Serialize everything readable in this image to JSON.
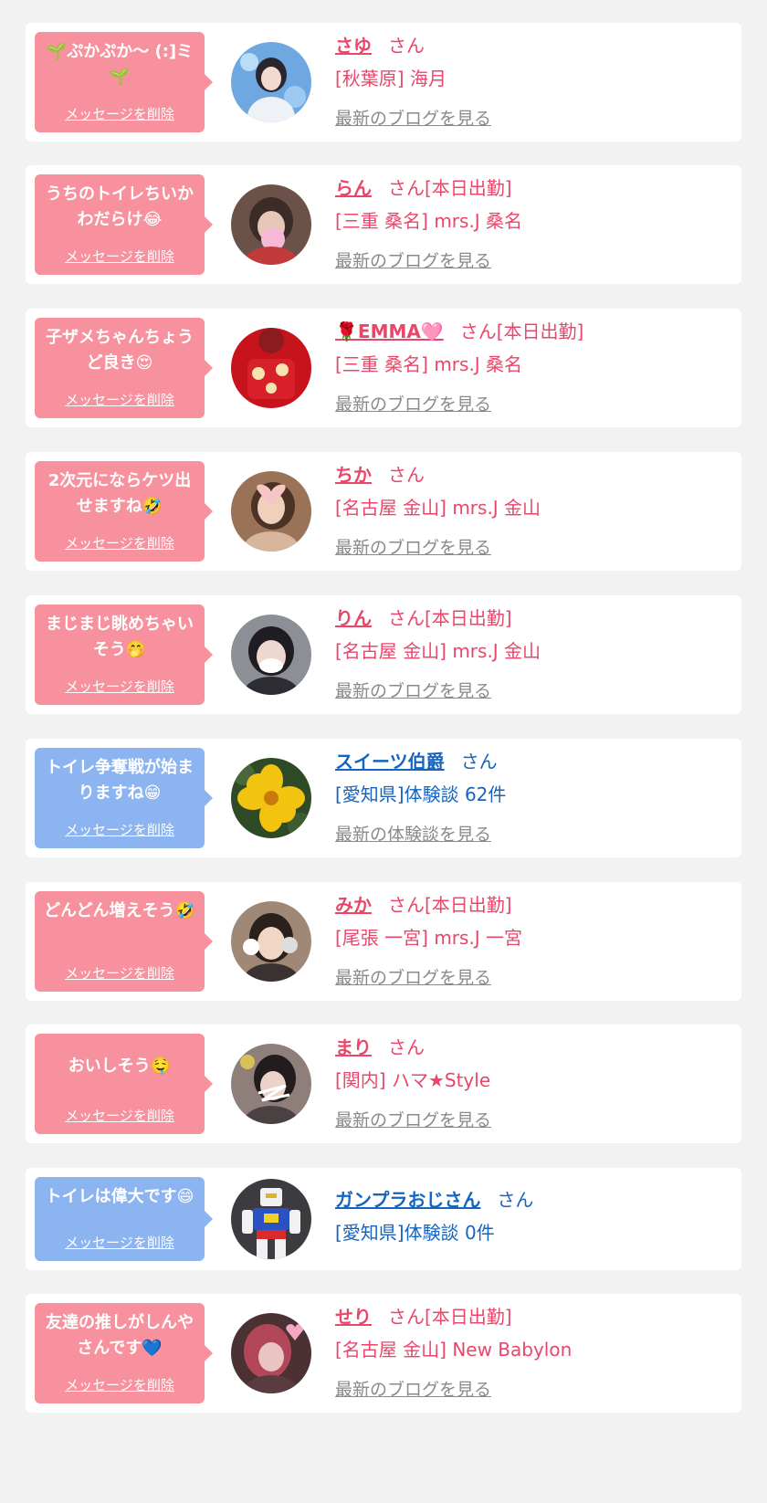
{
  "common": {
    "delete_label": "メッセージを削除",
    "san": "さん",
    "shift_badge": "[本日出勤]"
  },
  "colors": {
    "pink_text": "#e8476a",
    "blue_text": "#1565c0",
    "pink_bubble": "#f7919e",
    "blue_bubble": "#8cb4f0",
    "link_gray": "#8a8a8a"
  },
  "items": [
    {
      "message": "🌱ぷかぷか〜 (:]ミ🌱",
      "name": "さゆ",
      "badge": "",
      "subtitle": "[秋葉原] 海月",
      "link": "最新のブログを見る",
      "kind": "cast",
      "avatar_icon": "avatar-photo"
    },
    {
      "message": "うちのトイレちいかわだらけ😂",
      "name": "らん",
      "badge": "[本日出勤]",
      "subtitle": "[三重 桑名] mrs.J 桑名",
      "link": "最新のブログを見る",
      "kind": "cast",
      "avatar_icon": "avatar-photo"
    },
    {
      "message": "子ザメちゃんちょうど良き😍",
      "name": "🌹EMMA🩷",
      "badge": "[本日出勤]",
      "subtitle": "[三重 桑名] mrs.J 桑名",
      "link": "最新のブログを見る",
      "kind": "cast",
      "avatar_icon": "avatar-photo"
    },
    {
      "message": "2次元にならケツ出せますね🤣",
      "name": "ちか",
      "badge": "",
      "subtitle": "[名古屋 金山] mrs.J 金山",
      "link": "最新のブログを見る",
      "kind": "cast",
      "avatar_icon": "avatar-photo"
    },
    {
      "message": "まじまじ眺めちゃいそう🤭",
      "name": "りん",
      "badge": "[本日出勤]",
      "subtitle": "[名古屋 金山] mrs.J 金山",
      "link": "最新のブログを見る",
      "kind": "cast",
      "avatar_icon": "avatar-photo"
    },
    {
      "message": "トイレ争奪戦が始まりますね😁",
      "name": "スイーツ伯爵",
      "badge": "",
      "subtitle": "[愛知県]体験談 62件",
      "link": "最新の体験談を見る",
      "kind": "user",
      "avatar_icon": "flower-avatar"
    },
    {
      "message": "どんどん増えそう🤣",
      "name": "みか",
      "badge": "[本日出勤]",
      "subtitle": "[尾張 一宮] mrs.J 一宮",
      "link": "最新のブログを見る",
      "kind": "cast",
      "avatar_icon": "avatar-photo"
    },
    {
      "message": "おいしそう🤤",
      "name": "まり",
      "badge": "",
      "subtitle": "[関内] ハマ★Style",
      "link": "最新のブログを見る",
      "kind": "cast",
      "avatar_icon": "avatar-photo"
    },
    {
      "message": "トイレは偉大です😄",
      "name": "ガンプラおじさん",
      "badge": "",
      "subtitle": "[愛知県]体験談 0件",
      "link": "",
      "kind": "user",
      "avatar_icon": "robot-avatar"
    },
    {
      "message": "友達の推しがしんやさんです💙",
      "name": "せり",
      "badge": "[本日出勤]",
      "subtitle": "[名古屋 金山] New Babylon",
      "link": "最新のブログを見る",
      "kind": "cast",
      "avatar_icon": "avatar-photo"
    }
  ]
}
